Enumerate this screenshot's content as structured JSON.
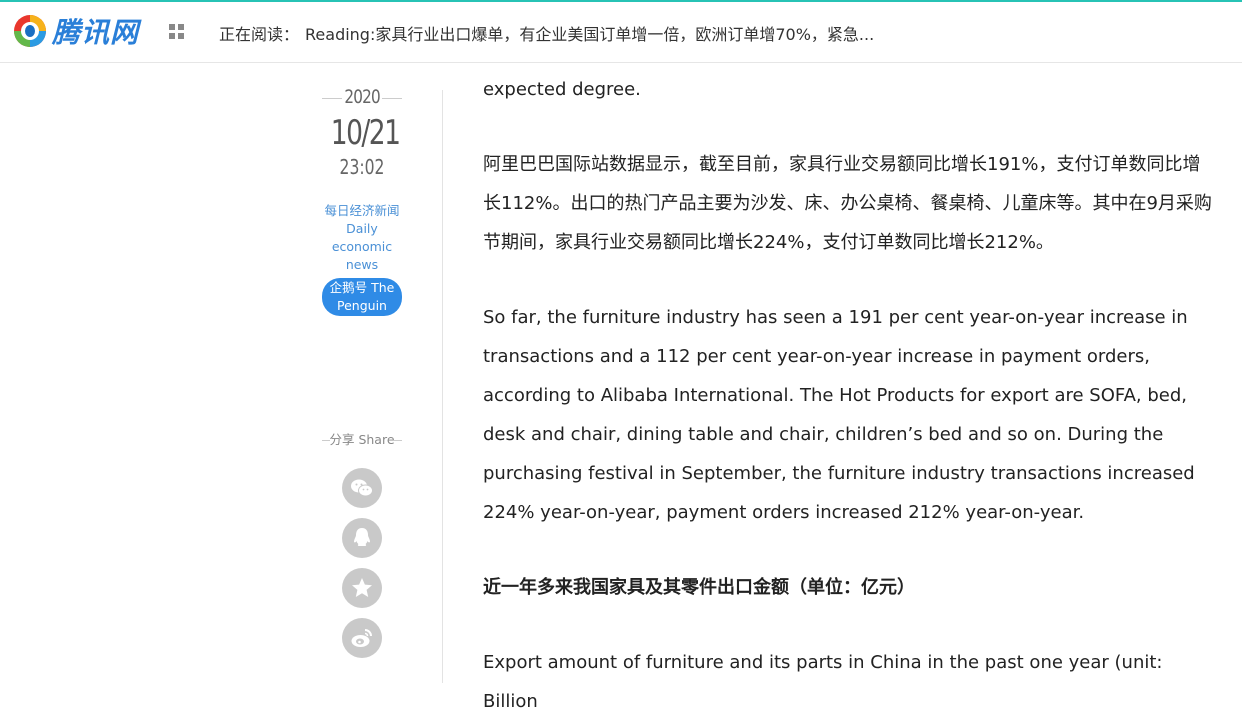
{
  "header": {
    "logo_text": "腾讯网",
    "reading_label": "正在阅读：",
    "reading_title": "Reading:家具行业出口爆单，有企业美国订单增一倍，欧洲订单增70%，紧急..."
  },
  "meta": {
    "year": "2020",
    "date": "10/21",
    "time": "23:02",
    "source_cn": "每日经济新闻",
    "source_en_1": "Daily",
    "source_en_2": "economic",
    "source_en_3": "news",
    "badge_1": "企鹅号 The",
    "badge_2": "Penguin"
  },
  "share": {
    "title": "分享 Share",
    "buttons": [
      "wechat-icon",
      "qq-icon",
      "favorite-icon",
      "weibo-icon"
    ]
  },
  "article": {
    "p0": "expected degree.",
    "p1": "阿里巴巴国际站数据显示，截至目前，家具行业交易额同比增长191%，支付订单数同比增长112%。出口的热门产品主要为沙发、床、办公桌椅、餐桌椅、儿童床等。其中在9月采购节期间，家具行业交易额同比增长224%，支付订单数同比增长212%。",
    "p2": "So far, the furniture industry has seen a 191 per cent year-on-year increase in transactions and a 112 per cent year-on-year increase in payment orders, according to Alibaba International. The Hot Products for export are SOFA, bed, desk and chair, dining table and chair, children’s bed and so on. During the purchasing festival in September, the furniture industry transactions increased 224% year-on-year, payment orders increased 212% year-on-year.",
    "heading": "近一年多来我国家具及其零件出口金额（单位：亿元）",
    "p3": "Export amount of furniture and its parts in China in the past one year (unit: Billion"
  },
  "colors": {
    "accent": "#2f8be6",
    "link": "#4a90d6",
    "topline": "#27c3b5"
  }
}
